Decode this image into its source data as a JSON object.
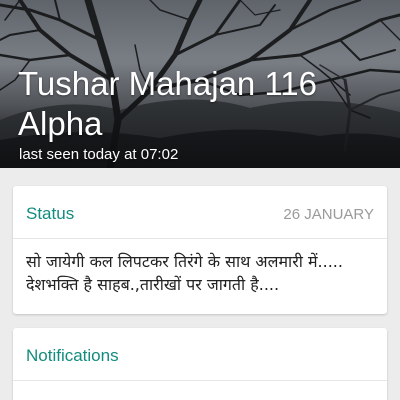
{
  "header": {
    "contact_name": "Tushar Mahajan 116 Alpha",
    "last_seen": "last seen today at 07:02"
  },
  "status_card": {
    "title": "Status",
    "date": "26 JANUARY",
    "text": "सो जायेगी कल लिपटकर तिरंगे के साथ अलमारी में.....  देशभक्ति है साहब.,तारीखों पर जागती है...."
  },
  "notifications_card": {
    "title": "Notifications"
  },
  "colors": {
    "accent": "#128c7e",
    "background": "#ececec",
    "card": "#ffffff",
    "muted_text": "#9a9a9a"
  }
}
